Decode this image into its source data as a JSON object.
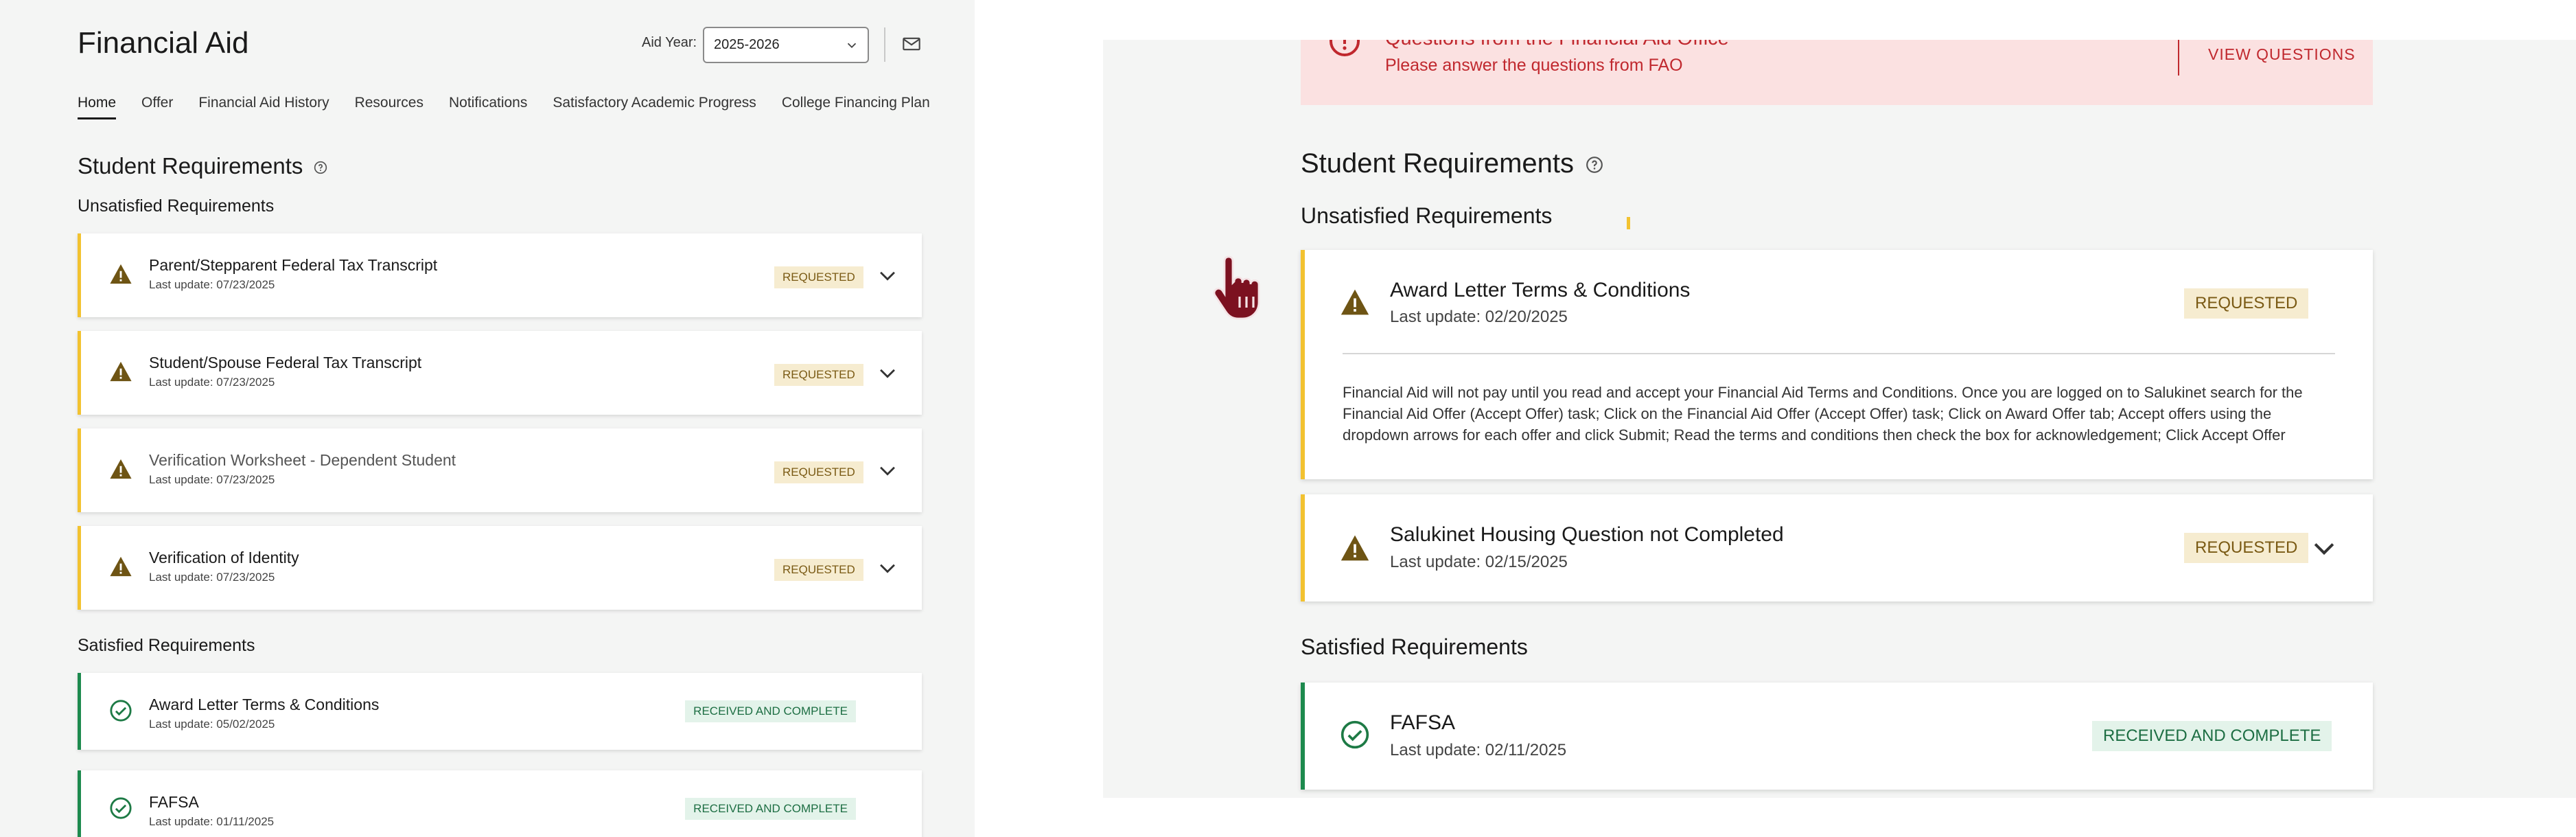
{
  "left": {
    "title": "Financial Aid",
    "aid_year_label": "Aid Year:",
    "aid_year_value": "2025-2026",
    "tabs": [
      {
        "label": "Home",
        "active": true
      },
      {
        "label": "Offer"
      },
      {
        "label": "Financial Aid History"
      },
      {
        "label": "Resources"
      },
      {
        "label": "Notifications"
      },
      {
        "label": "Satisfactory Academic Progress"
      },
      {
        "label": "College Financing Plan"
      }
    ],
    "section_title": "Student Requirements",
    "unsatisfied_title": "Unsatisfied Requirements",
    "unsatisfied": [
      {
        "name": "Parent/Stepparent Federal Tax Transcript",
        "date": "Last update: 07/23/2025",
        "status": "REQUESTED"
      },
      {
        "name": "Student/Spouse Federal Tax Transcript",
        "date": "Last update: 07/23/2025",
        "status": "REQUESTED"
      },
      {
        "name": "Verification Worksheet - Dependent Student",
        "date": "Last update: 07/23/2025",
        "status": "REQUESTED"
      },
      {
        "name": "Verification of Identity",
        "date": "Last update: 07/23/2025",
        "status": "REQUESTED"
      }
    ],
    "satisfied_title": "Satisfied Requirements",
    "satisfied": [
      {
        "name": "Award Letter Terms & Conditions",
        "date": "Last update: 05/02/2025",
        "status": "RECEIVED AND COMPLETE"
      },
      {
        "name": "FAFSA",
        "date": "Last update: 01/11/2025",
        "status": "RECEIVED AND COMPLETE"
      }
    ]
  },
  "right": {
    "alert": {
      "title": "Questions from the Financial Aid Office",
      "message": "Please answer the questions from FAO",
      "action": "VIEW QUESTIONS"
    },
    "section_title": "Student Requirements",
    "unsatisfied_title": "Unsatisfied Requirements",
    "unsatisfied": [
      {
        "name": "Award Letter Terms & Conditions",
        "date": "Last update: 02/20/2025",
        "status": "REQUESTED",
        "body": "Financial Aid will not pay until you read and accept your Financial Aid Terms and Conditions. Once you are logged on to Salukinet search for the Financial Aid Offer (Accept Offer) task; Click on the Financial Aid Offer (Accept Offer) task; Click on Award Offer tab; Accept offers using the dropdown arrows for each offer and click Submit; Read the terms and conditions then check the box for acknowledgement; Click Accept Offer"
      },
      {
        "name": "Salukinet Housing Question not Completed",
        "date": "Last update: 02/15/2025",
        "status": "REQUESTED"
      }
    ],
    "satisfied_title": "Satisfied Requirements",
    "satisfied": [
      {
        "name": "FAFSA",
        "date": "Last update: 02/11/2025",
        "status": "RECEIVED AND COMPLETE"
      }
    ]
  },
  "colors": {
    "warning_border": "#f2c230",
    "complete_border": "#1d8a4e",
    "requested_badge_bg": "#f6ecd0",
    "complete_badge_bg": "#e3f3ea",
    "alert_bg": "#fbe1e1",
    "alert_text": "#c0282e",
    "warning_icon": "#6e5414",
    "cursor": "#7c1120"
  }
}
